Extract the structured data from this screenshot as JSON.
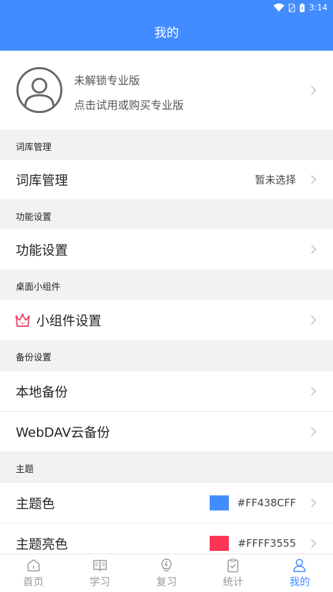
{
  "status_bar": {
    "time": "3:14"
  },
  "header": {
    "title": "我的"
  },
  "profile": {
    "line1": "未解锁专业版",
    "line2": "点击试用或购买专业版"
  },
  "sections": {
    "dictionary": {
      "header": "词库管理",
      "row_label": "词库管理",
      "row_value": "暂未选择"
    },
    "features": {
      "header": "功能设置",
      "row_label": "功能设置"
    },
    "widget": {
      "header": "桌面小组件",
      "row_label": "小组件设置"
    },
    "backup": {
      "header": "备份设置",
      "local_label": "本地备份",
      "webdav_label": "WebDAV云备份"
    },
    "theme": {
      "header": "主题",
      "color_label": "主题色",
      "color_value": "#FF438CFF",
      "color_swatch": "#438cff",
      "light_label": "主题亮色",
      "light_value": "#FFFF3555",
      "light_swatch": "#ff3555"
    }
  },
  "bottom_nav": {
    "items": [
      {
        "label": "首页",
        "icon": "home-icon",
        "active": false
      },
      {
        "label": "学习",
        "icon": "book-icon",
        "active": false
      },
      {
        "label": "复习",
        "icon": "lightbulb-icon",
        "active": false
      },
      {
        "label": "统计",
        "icon": "clipboard-check-icon",
        "active": false
      },
      {
        "label": "我的",
        "icon": "user-icon",
        "active": true
      }
    ]
  },
  "colors": {
    "accent": "#438cff",
    "background": "#f2f2f2",
    "crown": "#e84a6a"
  }
}
